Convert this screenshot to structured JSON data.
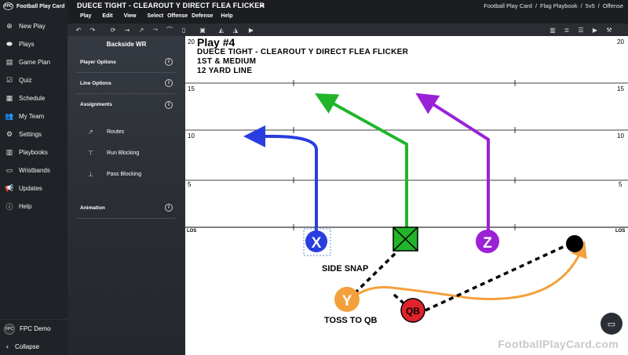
{
  "app": {
    "name": "Football Play Card"
  },
  "header": {
    "play_title": "DUECE TIGHT - CLEAROUT Y DIRECT FLEA FLICKER",
    "breadcrumb": [
      "Football Play Card",
      "/",
      "Flag Playbook",
      "/",
      "5v5",
      "/",
      "Offense"
    ],
    "menu": [
      "Play",
      "Edit",
      "View",
      "Select",
      "Offense",
      "Defense",
      "Help"
    ]
  },
  "sidebar": {
    "items": [
      {
        "label": "New Play",
        "icon": "plus-circle-icon"
      },
      {
        "label": "Plays",
        "icon": "football-icon"
      },
      {
        "label": "Game Plan",
        "icon": "clipboard-icon"
      },
      {
        "label": "Quiz",
        "icon": "quiz-icon"
      },
      {
        "label": "Schedule",
        "icon": "calendar-icon"
      },
      {
        "label": "My Team",
        "icon": "team-icon"
      },
      {
        "label": "Settings",
        "icon": "gear-icon"
      },
      {
        "label": "Playbooks",
        "icon": "book-icon"
      },
      {
        "label": "Wristbands",
        "icon": "wristband-icon"
      },
      {
        "label": "Updates",
        "icon": "megaphone-icon"
      },
      {
        "label": "Help",
        "icon": "help-icon"
      }
    ],
    "user": "FPC Demo",
    "collapse": "Collapse"
  },
  "panel": {
    "title": "Backside WR",
    "sections": [
      "Player Options",
      "Line Options",
      "Assignments"
    ],
    "assignments": [
      "Routes",
      "Run Blocking",
      "Pass Blocking"
    ],
    "animation": "Animation",
    "info_glyph": "i"
  },
  "field": {
    "play_number": "Play #4",
    "play_name": "DUECE TIGHT - CLEAROUT Y DIRECT FLEA FLICKER",
    "down": "1ST & MEDIUM",
    "yard_line": "12 YARD LINE",
    "yard_labels": [
      "20",
      "15",
      "10",
      "5",
      "LOS"
    ],
    "annotations": [
      "SIDE SNAP",
      "TOSS TO QB"
    ],
    "players": [
      {
        "label": "X",
        "color": "#2a3de0"
      },
      {
        "label": "Z",
        "color": "#9a22d6"
      },
      {
        "label": "Y",
        "color": "#f4a03c"
      },
      {
        "label": "QB",
        "color": "#e0222a"
      }
    ],
    "colors": {
      "x_route": "#2a3de0",
      "center_route": "#22b52a",
      "z_route": "#9a22d6",
      "y_motion": "#f4a03c",
      "pass_line": "#000000"
    }
  },
  "watermark": "FootballPlayCard.com"
}
